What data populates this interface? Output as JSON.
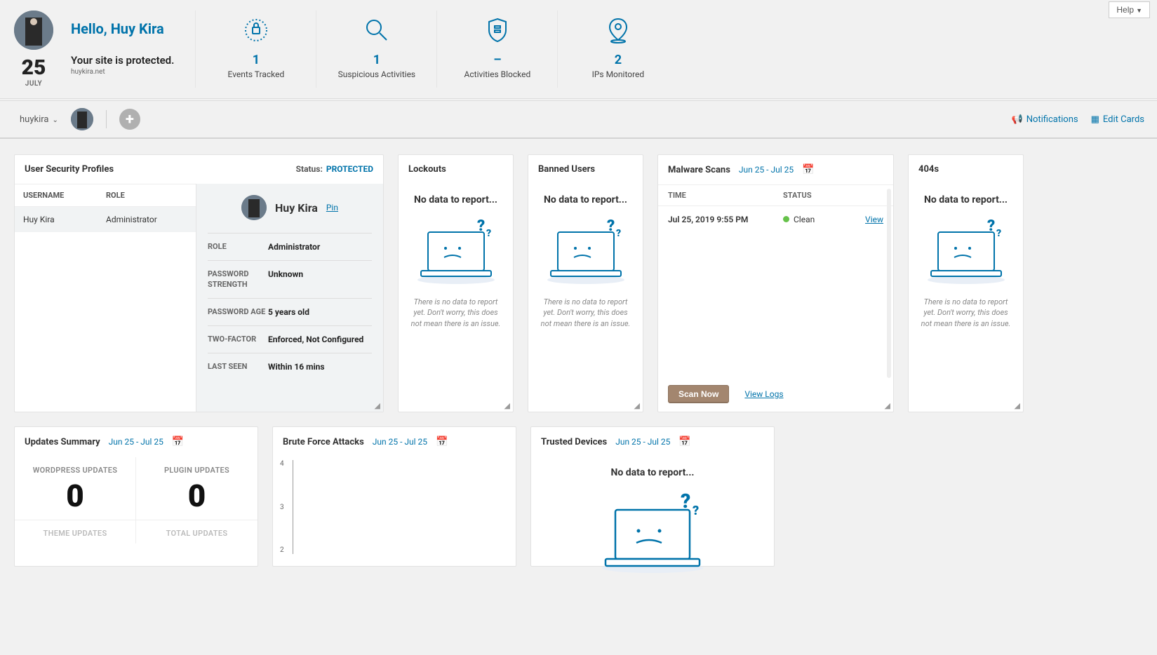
{
  "help": "Help",
  "header": {
    "greeting": "Hello, Huy Kira",
    "protected": "Your site is protected.",
    "host": "huykira.net",
    "day": "25",
    "month": "JULY"
  },
  "stats": [
    {
      "value": "1",
      "label": "Events Tracked"
    },
    {
      "value": "1",
      "label": "Suspicious Activities"
    },
    {
      "value": "–",
      "label": "Activities Blocked"
    },
    {
      "value": "2",
      "label": "IPs Monitored"
    }
  ],
  "subheader": {
    "site": "huykira",
    "notifications": "Notifications",
    "edit_cards": "Edit Cards"
  },
  "usp": {
    "title": "User Security Profiles",
    "status_label": "Status:",
    "status_value": "PROTECTED",
    "cols": {
      "username": "USERNAME",
      "role": "ROLE"
    },
    "rows": [
      {
        "username": "Huy Kira",
        "role": "Administrator"
      }
    ],
    "detail": {
      "name": "Huy Kira",
      "pin": "Pin",
      "fields": [
        {
          "key": "ROLE",
          "val": "Administrator"
        },
        {
          "key": "PASSWORD STRENGTH",
          "val": "Unknown"
        },
        {
          "key": "PASSWORD AGE",
          "val": "5 years old"
        },
        {
          "key": "TWO-FACTOR",
          "val": "Enforced, Not Configured"
        },
        {
          "key": "LAST SEEN",
          "val": "Within 16 mins"
        }
      ]
    }
  },
  "lockouts": {
    "title": "Lockouts",
    "heading": "No data to report...",
    "desc": "There is no data to report yet. Don't worry, this does not mean there is an issue."
  },
  "banned": {
    "title": "Banned Users",
    "heading": "No data to report...",
    "desc": "There is no data to report yet. Don't worry, this does not mean there is an issue."
  },
  "malware": {
    "title": "Malware Scans",
    "range": "Jun 25 - Jul 25",
    "th_time": "TIME",
    "th_status": "STATUS",
    "rows": [
      {
        "time": "Jul 25, 2019 9:55 PM",
        "status": "Clean",
        "view": "View"
      }
    ],
    "scan_now": "Scan Now",
    "view_logs": "View Logs"
  },
  "p404": {
    "title": "404s",
    "heading": "No data to report...",
    "desc": "There is no data to report yet. Don't worry, this does not mean there is an issue."
  },
  "updates": {
    "title": "Updates Summary",
    "range": "Jun 25 - Jul 25",
    "cells": [
      {
        "label": "WORDPRESS UPDATES",
        "num": "0"
      },
      {
        "label": "PLUGIN UPDATES",
        "num": "0"
      },
      {
        "label": "THEME UPDATES",
        "num": ""
      },
      {
        "label": "TOTAL UPDATES",
        "num": ""
      }
    ]
  },
  "brute": {
    "title": "Brute Force Attacks",
    "range": "Jun 25 - Jul 25"
  },
  "trusted": {
    "title": "Trusted Devices",
    "range": "Jun 25 - Jul 25",
    "heading": "No data to report..."
  },
  "chart_data": {
    "type": "line",
    "title": "Brute Force Attacks",
    "ylim": [
      0,
      4
    ],
    "yticks": [
      4,
      3,
      2
    ],
    "series": []
  }
}
